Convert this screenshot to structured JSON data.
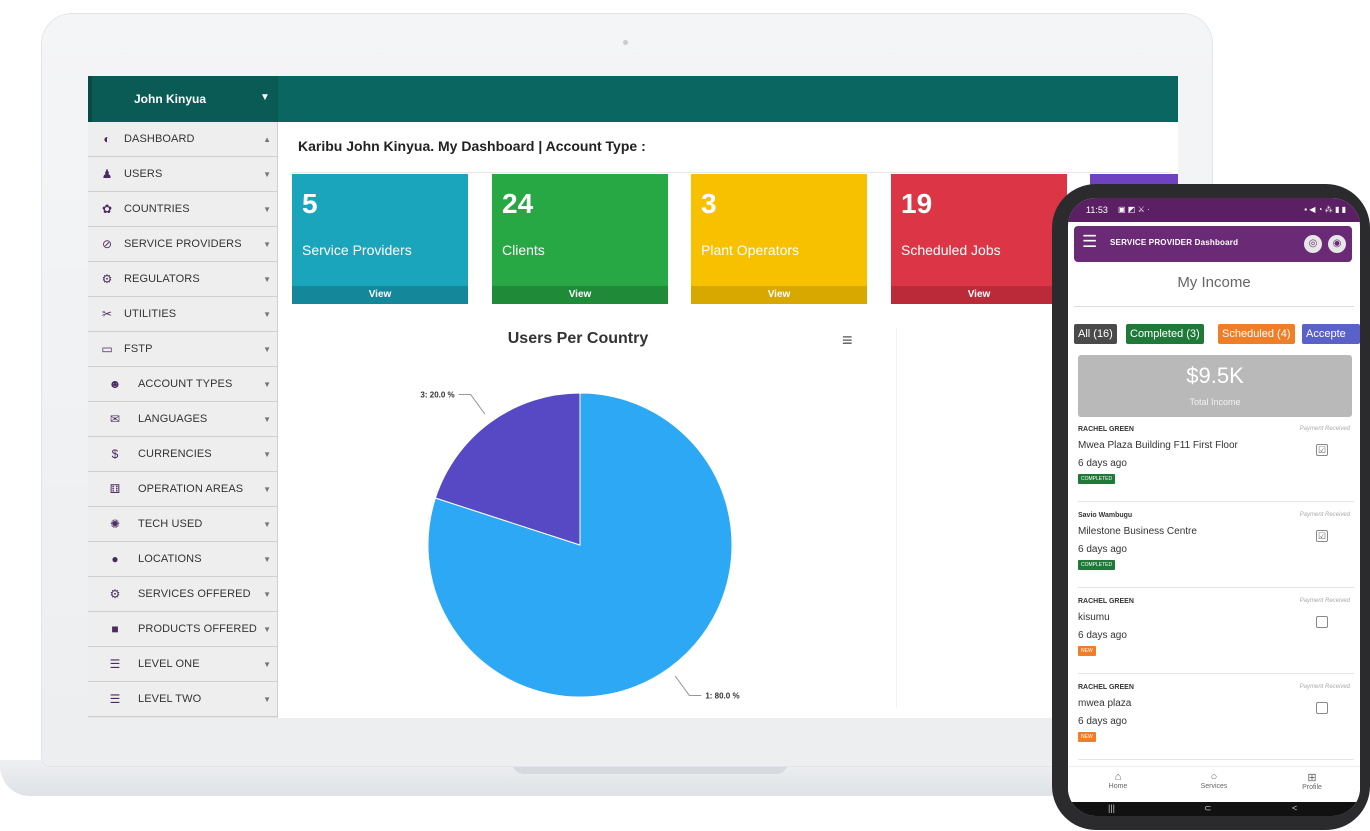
{
  "app": {
    "user_name": "John Kinyua",
    "welcome": "Karibu John Kinyua. My Dashboard | Account Type :"
  },
  "sidebar": {
    "items": [
      {
        "label": "DASHBOARD",
        "icon": "dashboard-icon",
        "caret": "▲"
      },
      {
        "label": "USERS",
        "icon": "user-icon",
        "caret": "▼"
      },
      {
        "label": "COUNTRIES",
        "icon": "globe-icon",
        "caret": "▼"
      },
      {
        "label": "SERVICE PROVIDERS",
        "icon": "link-icon",
        "caret": "▼"
      },
      {
        "label": "REGULATORS",
        "icon": "regulator-icon",
        "caret": "▼"
      },
      {
        "label": "UTILITIES",
        "icon": "tools-icon",
        "caret": "▼"
      },
      {
        "label": "FSTP",
        "icon": "truck-icon",
        "caret": "▼"
      },
      {
        "label": "ACCOUNT TYPES",
        "icon": "account-icon",
        "caret": "▼"
      },
      {
        "label": "LANGUAGES",
        "icon": "language-icon",
        "caret": "▼"
      },
      {
        "label": "CURRENCIES",
        "icon": "currency-icon",
        "caret": "▼"
      },
      {
        "label": "OPERATION AREAS",
        "icon": "map-icon",
        "caret": "▼"
      },
      {
        "label": "TECH USED",
        "icon": "chip-icon",
        "caret": "▼"
      },
      {
        "label": "LOCATIONS",
        "icon": "location-pin-icon",
        "caret": "▼"
      },
      {
        "label": "SERVICES OFFERED",
        "icon": "gears-icon",
        "caret": "▼"
      },
      {
        "label": "PRODUCTS OFFERED",
        "icon": "box-icon",
        "caret": "▼"
      },
      {
        "label": "LEVEL ONE",
        "icon": "level-icon",
        "caret": "▼"
      },
      {
        "label": "LEVEL TWO",
        "icon": "level-icon",
        "caret": "▼"
      }
    ]
  },
  "cards": [
    {
      "num": "5",
      "title": "Service Providers",
      "link": "View",
      "color": "#1ba5bd",
      "foot": "#15879b"
    },
    {
      "num": "24",
      "title": "Clients",
      "link": "View",
      "color": "#28a745",
      "foot": "#1f8a38"
    },
    {
      "num": "3",
      "title": "Plant Operators",
      "link": "View",
      "color": "#f8c100",
      "foot": "#d8a800"
    },
    {
      "num": "19",
      "title": "Scheduled Jobs",
      "link": "View",
      "color": "#dc3545",
      "foot": "#bb2a38"
    }
  ],
  "extra_card_color": "#6f42c1",
  "chart_data": {
    "type": "pie",
    "title": "Users Per Country",
    "slices": [
      {
        "label": "1: 80.0 %",
        "value": 80.0,
        "color": "#2ca8f5"
      },
      {
        "label": "3: 20.0 %",
        "value": 20.0,
        "color": "#5749c4"
      }
    ],
    "menu_icon": "hamburger-icon"
  },
  "phone": {
    "status_time": "11:53",
    "status_icons": "▣ ◩ ⚔ ·",
    "status_right": "▪ ◀ ◔ ⁂ ▮ ▮",
    "appbar_title": "SERVICE PROVIDER Dashboard",
    "income_title": "My Income",
    "chips": [
      {
        "label": "All (16)",
        "color": "#4a4a4a"
      },
      {
        "label": "Completed (3)",
        "color": "#1f7a3a"
      },
      {
        "label": "Scheduled (4)",
        "color": "#f07e28"
      },
      {
        "label": "Accepte",
        "color": "#5a61c9"
      }
    ],
    "total_value": "$9.5K",
    "total_label": "Total Income",
    "jobs": [
      {
        "name": "RACHEL GREEN",
        "payment": "Payment Received",
        "location": "Mwea Plaza Building F11 First Floor",
        "ago": "6 days ago",
        "badge": "COMPLETED",
        "badge_color": "#1f7a3a",
        "checked": "☑"
      },
      {
        "name": "Savio Wambugu",
        "payment": "Payment Received",
        "location": "Milestone Business Centre",
        "ago": "6 days ago",
        "badge": "COMPLETED",
        "badge_color": "#1f7a3a",
        "checked": "☑"
      },
      {
        "name": "RACHEL GREEN",
        "payment": "Payment Received",
        "location": "kisumu",
        "ago": "6 days ago",
        "badge": "NEW",
        "badge_color": "#f07e28",
        "checked": ""
      },
      {
        "name": "RACHEL GREEN",
        "payment": "Payment Received",
        "location": "mwea plaza",
        "ago": "6 days ago",
        "badge": "NEW",
        "badge_color": "#f07e28",
        "checked": ""
      }
    ],
    "nav": [
      {
        "icon": "⌂",
        "label": "Home"
      },
      {
        "icon": "○",
        "label": "Services"
      },
      {
        "icon": "⊞",
        "label": "Profile"
      }
    ],
    "sys": [
      "|||",
      "⊂",
      "<"
    ]
  }
}
